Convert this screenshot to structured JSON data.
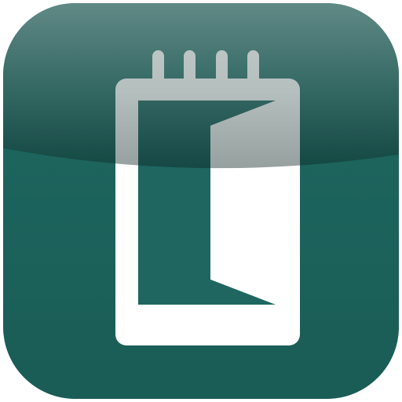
{
  "icon": {
    "name": "notepad-door-app-icon",
    "symbol": "notepad-with-open-door",
    "spiral_rings": 4,
    "colors": {
      "background": "#1E6660",
      "background_dark": "#174F4A",
      "gloss_top": "#6B9792",
      "notepad": "#FFFFFF",
      "door_opening": "#1F6661"
    }
  }
}
